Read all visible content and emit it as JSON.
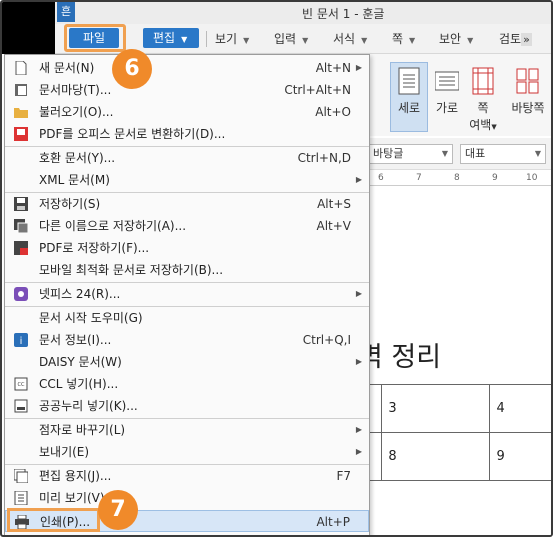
{
  "titlebar": {
    "logo_char": "흔",
    "title": "빈 문서 1 - 훈글"
  },
  "menubar": {
    "file_label": "파일",
    "edit_label": "편집",
    "items": [
      {
        "label": "보기"
      },
      {
        "label": "입력"
      },
      {
        "label": "서식"
      },
      {
        "label": "쪽"
      },
      {
        "label": "보안"
      },
      {
        "label": "검토"
      }
    ],
    "more_label": "»"
  },
  "ribbon": {
    "buttons": [
      {
        "label": "세로",
        "selected": true
      },
      {
        "label": "가로",
        "selected": false
      },
      {
        "label": "쪽",
        "label2": "여백",
        "selected": false
      },
      {
        "label": "바탕쪽",
        "selected": false
      }
    ]
  },
  "formatbar": {
    "style_combo": "바탕글",
    "font_combo": "대표"
  },
  "ruler": {
    "ticks": [
      "6",
      "7",
      "8",
      "9",
      "10"
    ]
  },
  "document": {
    "heading_fragment": "벽 정리",
    "table_rows": [
      [
        "",
        "3",
        "4"
      ],
      [
        "",
        "8",
        "9"
      ]
    ]
  },
  "file_menu": {
    "items": [
      {
        "label": "새 문서(N)",
        "shortcut": "Alt+N",
        "submenu": true,
        "icon": "new-document-icon"
      },
      {
        "label": "문서마당(T)...",
        "shortcut": "Ctrl+Alt+N",
        "submenu": false,
        "icon": "template-icon"
      },
      {
        "label": "불러오기(O)...",
        "shortcut": "Alt+O",
        "submenu": false,
        "icon": "open-folder-icon"
      },
      {
        "label": "PDF를 오피스 문서로 변환하기(D)...",
        "shortcut": "",
        "submenu": false,
        "icon": "pdf-convert-icon"
      },
      {
        "label": "호환 문서(Y)...",
        "shortcut": "Ctrl+N,D",
        "submenu": false,
        "icon": ""
      },
      {
        "label": "XML 문서(M)",
        "shortcut": "",
        "submenu": true,
        "icon": ""
      },
      {
        "label": "저장하기(S)",
        "shortcut": "Alt+S",
        "submenu": false,
        "icon": "save-icon"
      },
      {
        "label": "다른 이름으로 저장하기(A)...",
        "shortcut": "Alt+V",
        "submenu": false,
        "icon": "save-as-icon"
      },
      {
        "label": "PDF로 저장하기(F)...",
        "shortcut": "",
        "submenu": false,
        "icon": "save-pdf-icon"
      },
      {
        "label": "모바일 최적화 문서로 저장하기(B)...",
        "shortcut": "",
        "submenu": false,
        "icon": ""
      },
      {
        "label": "넷피스 24(R)...",
        "shortcut": "",
        "submenu": true,
        "icon": "netffice-icon"
      },
      {
        "label": "문서 시작 도우미(G)",
        "shortcut": "",
        "submenu": false,
        "icon": ""
      },
      {
        "label": "문서 정보(I)...",
        "shortcut": "Ctrl+Q,I",
        "submenu": false,
        "icon": "info-icon"
      },
      {
        "label": "DAISY 문서(W)",
        "shortcut": "",
        "submenu": true,
        "icon": ""
      },
      {
        "label": "CCL 넣기(H)...",
        "shortcut": "",
        "submenu": false,
        "icon": "ccl-icon"
      },
      {
        "label": "공공누리 넣기(K)...",
        "shortcut": "",
        "submenu": false,
        "icon": "kogl-icon"
      },
      {
        "label": "점자로 바꾸기(L)",
        "shortcut": "",
        "submenu": true,
        "icon": ""
      },
      {
        "label": "보내기(E)",
        "shortcut": "",
        "submenu": true,
        "icon": ""
      },
      {
        "label": "편집 용지(J)...",
        "shortcut": "F7",
        "submenu": false,
        "icon": "page-setup-icon"
      },
      {
        "label": "미리 보기(V)",
        "shortcut": "",
        "submenu": false,
        "icon": "preview-icon"
      },
      {
        "label": "인쇄(P)...",
        "shortcut": "Alt+P",
        "submenu": false,
        "icon": "print-icon"
      }
    ]
  },
  "annotations": {
    "step6": "6",
    "step7": "7"
  },
  "colors": {
    "accent_blue": "#2a78c8",
    "highlight_orange": "#f0a050",
    "badge_orange": "#f08a2a"
  }
}
